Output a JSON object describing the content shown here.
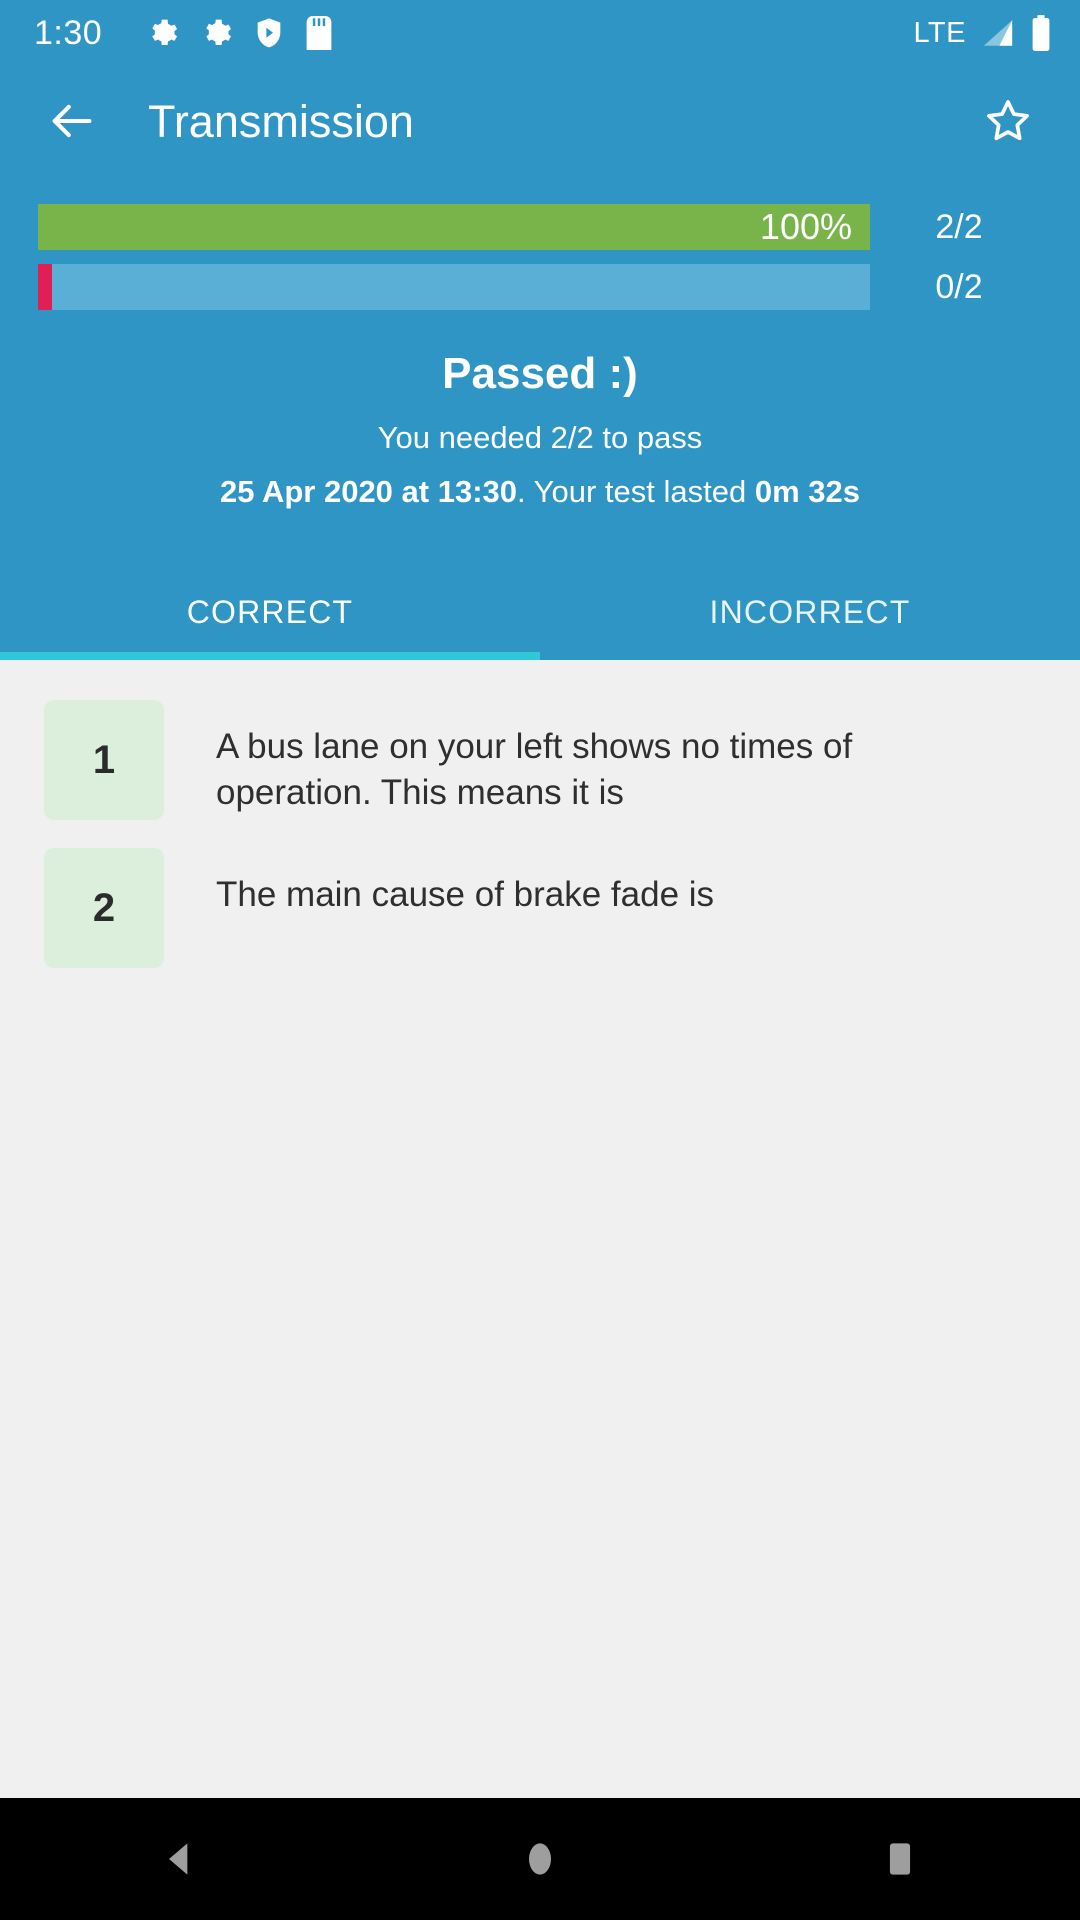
{
  "status_bar": {
    "clock": "1:30",
    "icons": [
      "gear-icon",
      "gear-icon",
      "shield-play-icon",
      "sd-card-icon"
    ],
    "network_label": "LTE",
    "right_icons": [
      "signal-icon",
      "battery-icon"
    ]
  },
  "app_bar": {
    "back_icon": "back-arrow-icon",
    "title": "Transmission",
    "favorite_icon": "star-outline-icon"
  },
  "result": {
    "bars": [
      {
        "label": "correct",
        "percent_text": "100%",
        "percent": 100,
        "count": "2/2",
        "fill_color": "#79b44a"
      },
      {
        "label": "incorrect",
        "percent_text": "",
        "percent": 1,
        "count": "0/2",
        "fill_color": "#e01f56"
      }
    ],
    "verdict": "Passed :)",
    "needed": "You needed 2/2 to pass",
    "when_date": "25 Apr 2020 at 13:30",
    "when_middle": ". Your test lasted ",
    "when_duration": "0m 32s"
  },
  "tabs": [
    {
      "label": "CORRECT",
      "active": true
    },
    {
      "label": "INCORRECT",
      "active": false
    }
  ],
  "questions": [
    {
      "number": "1",
      "text": "A bus lane on your left shows no times of operation. This means it is"
    },
    {
      "number": "2",
      "text": "The main cause of brake fade is"
    }
  ],
  "nav_bar": {
    "back": "nav-back-icon",
    "home": "nav-home-icon",
    "recents": "nav-recents-icon"
  },
  "colors": {
    "header_blue": "#2e95c4",
    "track_blue": "#5aafd6",
    "green": "#79b44a",
    "red": "#e01f56",
    "tab_indicator": "#2fc8d8",
    "badge_green": "#dcefdc",
    "content_bg": "#f0f0f0"
  }
}
